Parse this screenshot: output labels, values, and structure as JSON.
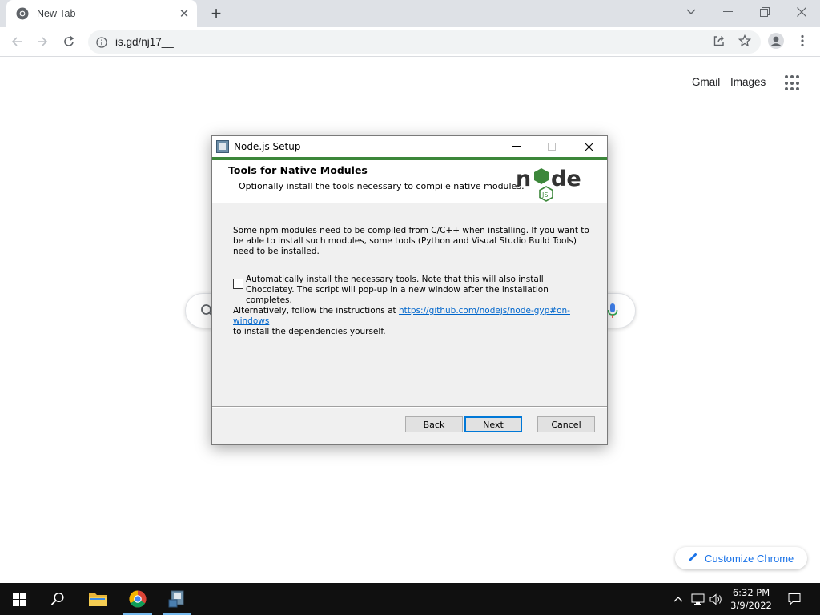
{
  "browser": {
    "tab_title": "New Tab",
    "url": "is.gd/nj17__"
  },
  "google": {
    "gmail_label": "Gmail",
    "images_label": "Images",
    "customize_label": "Customize Chrome"
  },
  "dialog": {
    "window_title": "Node.js Setup",
    "banner_title": "Tools for Native Modules",
    "banner_subtitle": "Optionally install the tools necessary to compile native modules.",
    "body_text": "Some npm modules need to be compiled from C/C++ when installing. If you want to be able to install such modules, some tools (Python and Visual Studio Build Tools) need to be installed.",
    "checkbox_label": "Automatically install the necessary tools. Note that this will also install Chocolatey. The script will pop-up in a new window after the installation completes.",
    "checkbox_checked": false,
    "alt_prefix": "Alternatively, follow the instructions at ",
    "alt_link": "https://github.com/nodejs/node-gyp#on-windows",
    "alt_suffix": "to install the dependencies yourself.",
    "buttons": {
      "back": "Back",
      "next": "Next",
      "cancel": "Cancel"
    }
  },
  "taskbar": {
    "time": "6:32 PM",
    "date": "3/9/2022"
  },
  "colors": {
    "node_green": "#3c873a",
    "link_blue": "#0066cc",
    "chrome_blue": "#1a73e8"
  }
}
